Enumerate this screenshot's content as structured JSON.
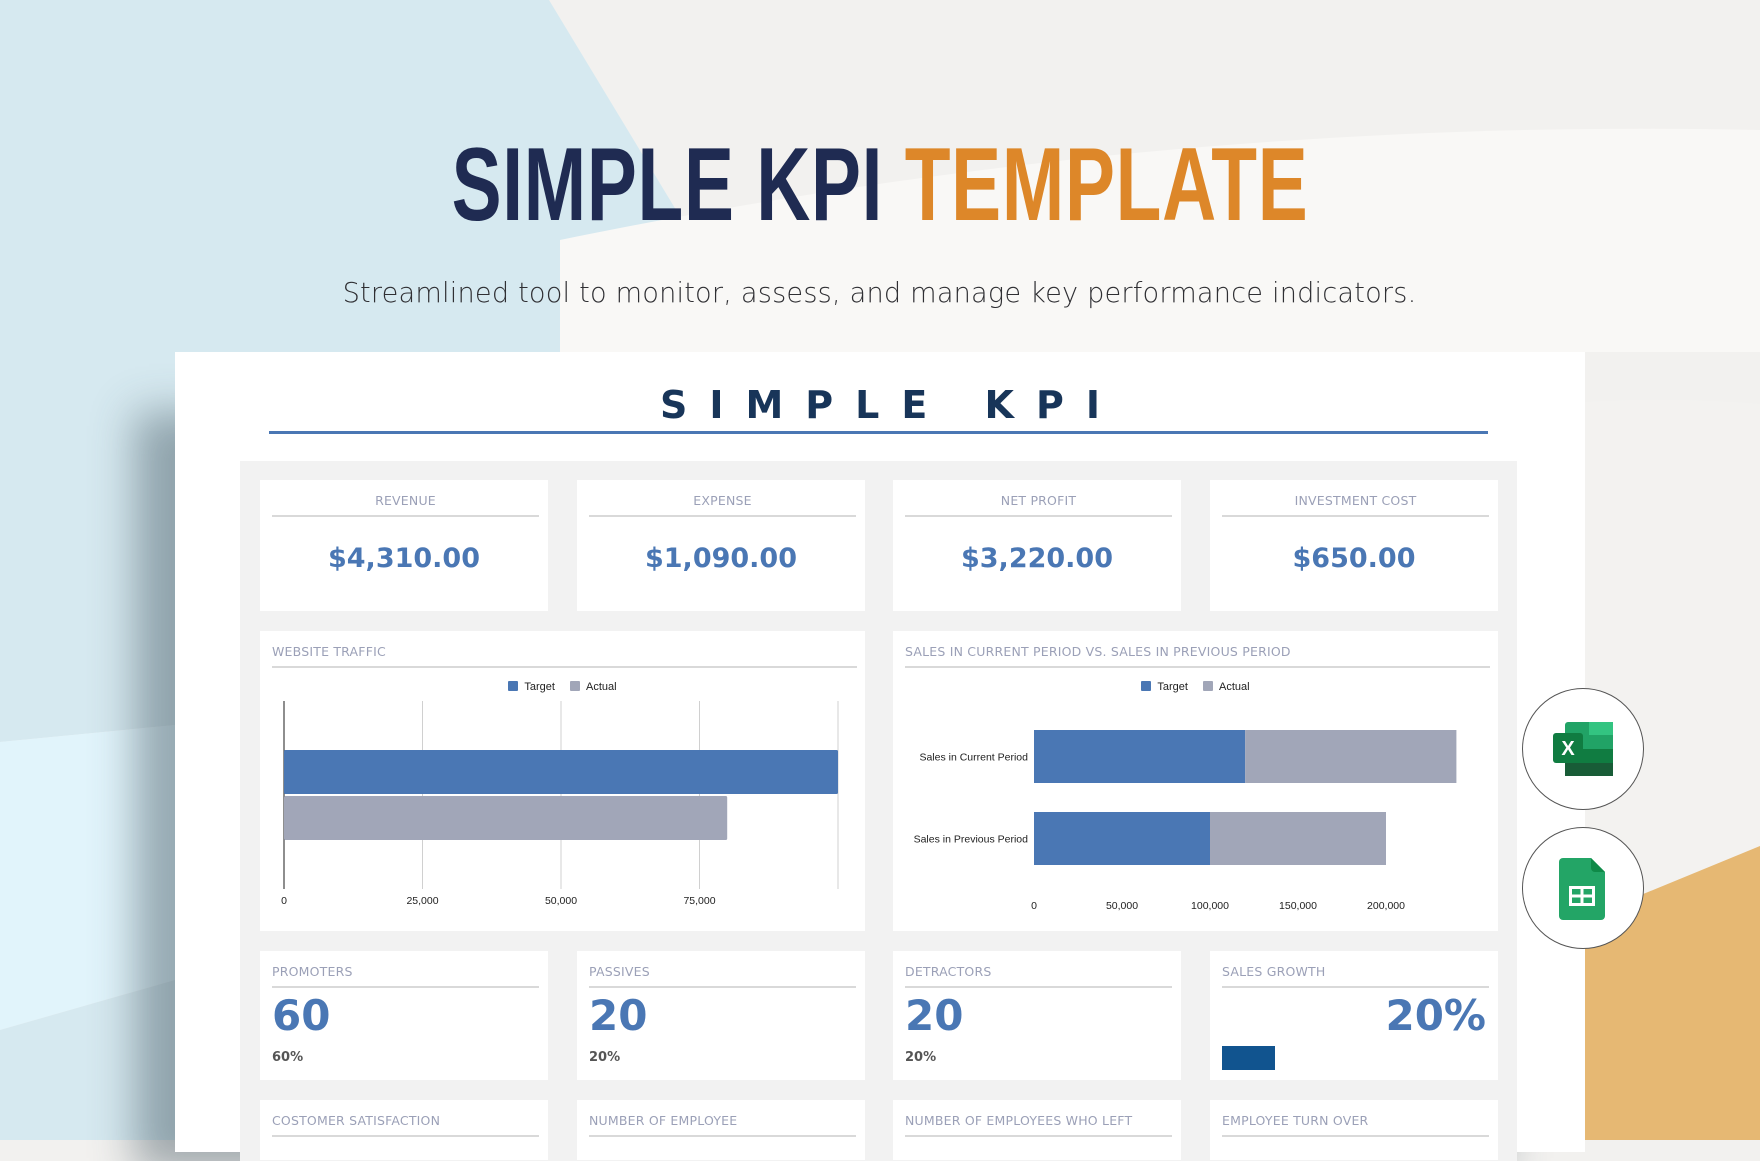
{
  "hero": {
    "title_part1": "SIMPLE KPI",
    "title_part2": "TEMPLATE",
    "subtitle": "Streamlined tool to monitor, assess, and manage key performance indicators."
  },
  "colors": {
    "navy": "#1f2b52",
    "orange": "#dd8729",
    "accent_blue": "#4a77b4",
    "actual_gray": "#a1a6b8",
    "progress_blue": "#11548f"
  },
  "document": {
    "title": "SIMPLE KPI",
    "kpi_cards": [
      {
        "label": "REVENUE",
        "value": "$4,310.00"
      },
      {
        "label": "EXPENSE",
        "value": "$1,090.00"
      },
      {
        "label": "NET PROFIT",
        "value": "$3,220.00"
      },
      {
        "label": "INVESTMENT COST",
        "value": "$650.00"
      }
    ],
    "nps_cards": [
      {
        "label": "PROMOTERS",
        "value": "60",
        "percent": "60%"
      },
      {
        "label": "PASSIVES",
        "value": "20",
        "percent": "20%"
      },
      {
        "label": "DETRACTORS",
        "value": "20",
        "percent": "20%"
      }
    ],
    "sales_growth": {
      "label": "SALES GROWTH",
      "value": "20%",
      "progress": 0.2
    },
    "bottom_cards": [
      {
        "label": "COSTOMER SATISFACTION"
      },
      {
        "label": "NUMBER OF EMPLOYEE"
      },
      {
        "label": "NUMBER OF EMPLOYEES WHO LEFT"
      },
      {
        "label": "EMPLOYEE TURN OVER"
      }
    ]
  },
  "chart_data": [
    {
      "type": "bar",
      "orientation": "horizontal",
      "title": "WEBSITE TRAFFIC",
      "legend": [
        "Target",
        "Actual"
      ],
      "legend_position": "top",
      "categories": [
        ""
      ],
      "series": [
        {
          "name": "Target",
          "values": [
            100000
          ]
        },
        {
          "name": "Actual",
          "values": [
            80000
          ]
        }
      ],
      "x_ticks": [
        0,
        25000,
        50000,
        75000
      ],
      "x_tick_labels": [
        "0",
        "25,000",
        "50,000",
        "75,000"
      ],
      "xlim": [
        0,
        100000
      ],
      "grid": true
    },
    {
      "type": "bar",
      "orientation": "horizontal",
      "stacked": true,
      "title": "SALES IN CURRENT PERIOD VS. SALES IN PREVIOUS PERIOD",
      "legend": [
        "Target",
        "Actual"
      ],
      "legend_position": "top",
      "categories": [
        "Sales in Current Period",
        "Sales in Previous Period"
      ],
      "series": [
        {
          "name": "Target",
          "values": [
            120000,
            100000
          ]
        },
        {
          "name": "Actual",
          "values": [
            120000,
            100000
          ]
        }
      ],
      "x_ticks": [
        0,
        50000,
        100000,
        150000,
        200000
      ],
      "x_tick_labels": [
        "0",
        "50,000",
        "100,000",
        "150,000",
        "200,000"
      ],
      "xlim": [
        0,
        240000
      ],
      "grid": false
    }
  ],
  "side_icons": [
    {
      "name": "microsoft-excel",
      "letter": "X"
    },
    {
      "name": "google-sheets"
    }
  ]
}
